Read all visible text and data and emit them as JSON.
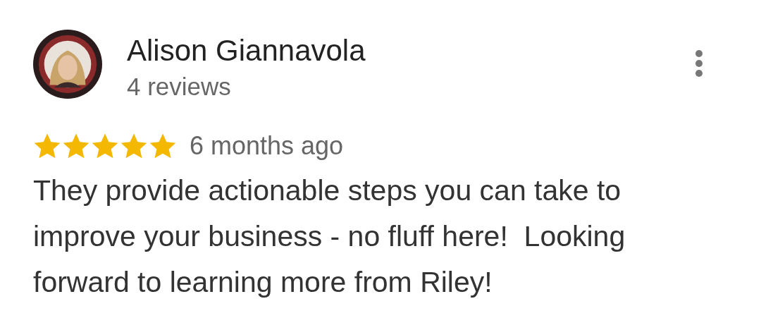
{
  "reviewer": {
    "name": "Alison Giannavola",
    "reviews": "4 reviews"
  },
  "review": {
    "stars": 5,
    "time": "6 months ago",
    "text": "They provide actionable steps you can take to improve your business - no fluff here!  Looking forward to learning more from Riley!"
  }
}
